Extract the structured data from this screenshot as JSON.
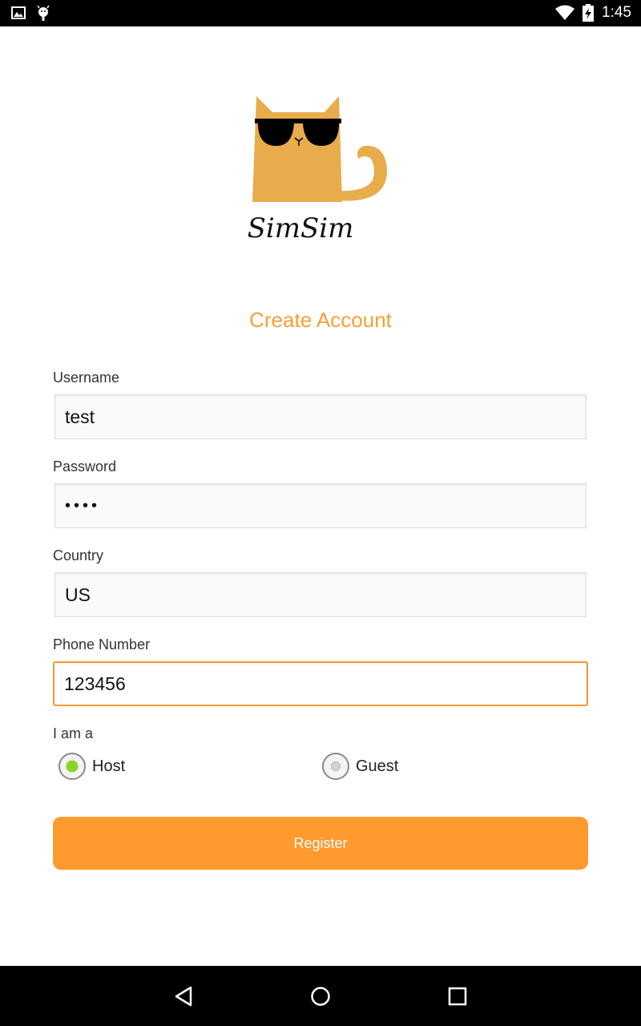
{
  "status_bar": {
    "time": "1:45",
    "left_icons": [
      "gallery-icon",
      "android-debug-icon"
    ],
    "right_icons": [
      "wifi-icon",
      "battery-charging-icon"
    ]
  },
  "logo": {
    "brand_name": "SimSim",
    "mascot": "cat-with-sunglasses-icon",
    "mascot_color": "#e8ac4b"
  },
  "page": {
    "title": "Create Account",
    "accent_color": "#f7a035"
  },
  "form": {
    "username": {
      "label": "Username",
      "value": "test"
    },
    "password": {
      "label": "Password",
      "value": "••••"
    },
    "country": {
      "label": "Country",
      "value": "US"
    },
    "phone": {
      "label": "Phone Number",
      "value": "123456",
      "focused": true
    },
    "role": {
      "label": "I am a",
      "options": [
        {
          "label": "Host",
          "selected": true
        },
        {
          "label": "Guest",
          "selected": false
        }
      ]
    },
    "register_label": "Register"
  },
  "nav_bar": {
    "buttons": [
      "back-icon",
      "home-icon",
      "recents-icon"
    ]
  }
}
